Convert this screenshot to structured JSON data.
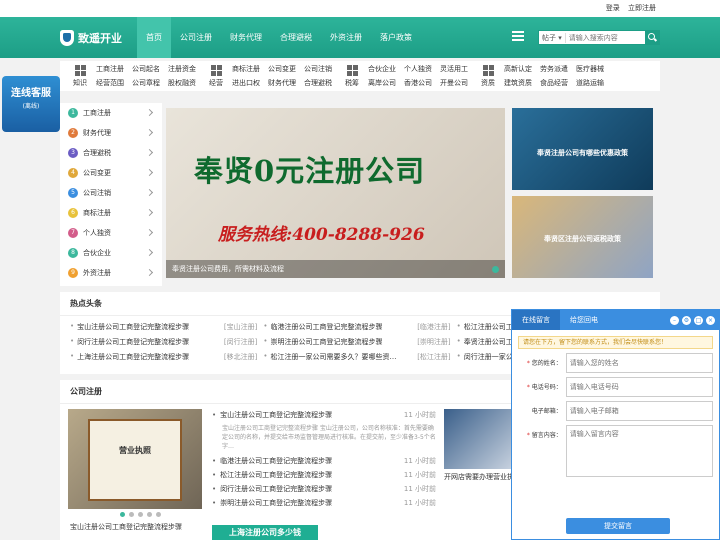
{
  "topbar": {
    "login": "登录",
    "register": "立即注册"
  },
  "header": {
    "logo_text": "致遥开业",
    "nav": [
      "首页",
      "公司注册",
      "财务代理",
      "合理避税",
      "外资注册",
      "落户政策"
    ],
    "search": {
      "type": "帖子",
      "placeholder": "请输入搜索内容"
    }
  },
  "categories": [
    {
      "label": "知识",
      "links": [
        "工商注册",
        "公司起名",
        "注册资金",
        "经营范围",
        "公司章程",
        "股权融资"
      ]
    },
    {
      "label": "经营",
      "links": [
        "商标注册",
        "公司变更",
        "公司注销",
        "进出口权",
        "财务代理",
        "合理避税"
      ]
    },
    {
      "label": "税筹",
      "links": [
        "合伙企业",
        "个人独资",
        "灵活用工",
        "离岸公司",
        "香港公司",
        "开曼公司"
      ]
    },
    {
      "label": "资质",
      "links": [
        "高新认定",
        "劳务派遣",
        "医疗器械",
        "建筑资质",
        "食品经营",
        "道路运输"
      ]
    }
  ],
  "sidebar": {
    "items": [
      {
        "num": "1",
        "label": "工商注册",
        "color": "#3cb89d"
      },
      {
        "num": "2",
        "label": "财务代理",
        "color": "#e07a3b"
      },
      {
        "num": "3",
        "label": "合理避税",
        "color": "#6b5cc4"
      },
      {
        "num": "4",
        "label": "公司变更",
        "color": "#e0a83b"
      },
      {
        "num": "5",
        "label": "公司注销",
        "color": "#3b8ee0"
      },
      {
        "num": "6",
        "label": "商标注册",
        "color": "#e8c23b"
      },
      {
        "num": "7",
        "label": "个人独资",
        "color": "#d35c8a"
      },
      {
        "num": "8",
        "label": "合伙企业",
        "color": "#3cb89d"
      },
      {
        "num": "9",
        "label": "外资注册",
        "color": "#f0a030"
      }
    ]
  },
  "banner": {
    "headline": "奉贤0元注册公司",
    "hotline": "服务热线:400-8288-926",
    "caption": "奉贤注册公司费用，所需材料及流程"
  },
  "thumbs": [
    "奉贤注册公司有哪些优惠政策",
    "奉贤区注册公司返税政策"
  ],
  "customer_service": {
    "title": "连线客服",
    "subtitle": "(离线)"
  },
  "hot": {
    "title": "热点头条",
    "rows": [
      [
        {
          "t": "宝山注册公司工商登记完整流程步骤",
          "tag": "[宝山注册]"
        },
        {
          "t": "临港注册公司工商登记完整流程步骤",
          "tag": "[临港注册]"
        },
        {
          "t": "松江注册公司工商登记完整流程步骤",
          "tag": ""
        }
      ],
      [
        {
          "t": "闵行注册公司工商登记完整流程步骤",
          "tag": "[闵行注册]"
        },
        {
          "t": "崇明注册公司工商登记完整流程步骤",
          "tag": "[崇明注册]"
        },
        {
          "t": "奉贤注册公司工商登记完整流程步骤",
          "tag": ""
        }
      ],
      [
        {
          "t": "上海注册公司工商登记完整流程步骤",
          "tag": "[移北注册]"
        },
        {
          "t": "松江注册一家公司需要多久？要哪些资…",
          "tag": "[松江注册]"
        },
        {
          "t": "闵行注册一家公司需要多久",
          "tag": ""
        }
      ]
    ]
  },
  "register": {
    "title": "公司注册",
    "image_text": "营业执照",
    "image_caption": "宝山注册公司工商登记完整流程步骤",
    "first": {
      "t": "宝山注册公司工商登记完整流程步骤",
      "ago": "11 小时前",
      "desc": "宝山注册公司工商登记完整流程步骤 宝山注册公司，公司名称核准：首先需要确定公司的名称，并提交给市场监督管理局进行核准。在提交前，至少准备3-5个名字…"
    },
    "items": [
      {
        "t": "临港注册公司工商登记完整流程步骤",
        "ago": "11 小时前"
      },
      {
        "t": "松江注册公司工商登记完整流程步骤",
        "ago": "11 小时前"
      },
      {
        "t": "闵行注册公司工商登记完整流程步骤",
        "ago": "11 小时前"
      },
      {
        "t": "崇明注册公司工商登记完整流程步骤",
        "ago": "11 小时前"
      }
    ],
    "ad": "上海注册公司多少钱",
    "right_caption": "开网店需要办理营业执"
  },
  "chat": {
    "tab_active": "在线留言",
    "tab_other": "给您回电",
    "notice": "请您在下方，留下您的联系方式，我们会尽快联系您！",
    "fields": [
      {
        "label": "您的姓名：",
        "placeholder": "请输入您的姓名",
        "required": true
      },
      {
        "label": "电话号码：",
        "placeholder": "请输入电话号码",
        "required": true
      },
      {
        "label": "电子邮箱：",
        "placeholder": "请输入电子邮箱",
        "required": false
      }
    ],
    "message": {
      "label": "留言内容：",
      "placeholder": "请输入留言内容",
      "required": true
    },
    "submit": "提交留言"
  }
}
